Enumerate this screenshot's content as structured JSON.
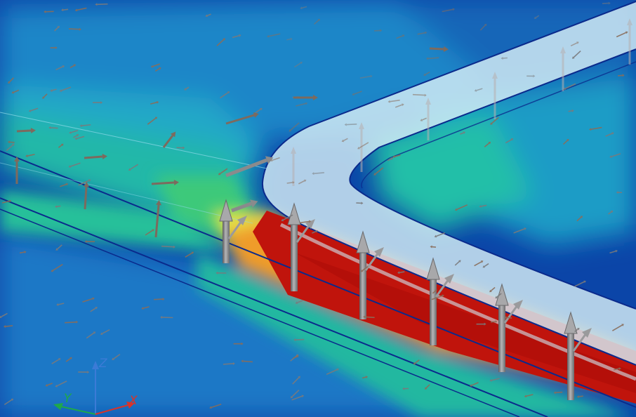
{
  "viewport": {
    "background_color": "#0b45a8",
    "palette": {
      "deep_blue": "#0b3f9e",
      "blue": "#1f6fc4",
      "cyan": "#1fb0c8",
      "teal_green": "#22c29a",
      "green": "#5fd050",
      "yellow": "#e8e84a",
      "orange": "#f39a2a",
      "red": "#c0140c",
      "dark_red": "#a80a05",
      "outline": "#0a2a8c",
      "translucent_plate": "#cfe8f2",
      "arrow_gray": "#8f8f90"
    }
  },
  "triad": {
    "z_label": "Z",
    "y_label": "Y",
    "x_label": "X",
    "z_color": "#3b7bd6",
    "y_color": "#1fa84a",
    "x_color": "#d8342a"
  }
}
